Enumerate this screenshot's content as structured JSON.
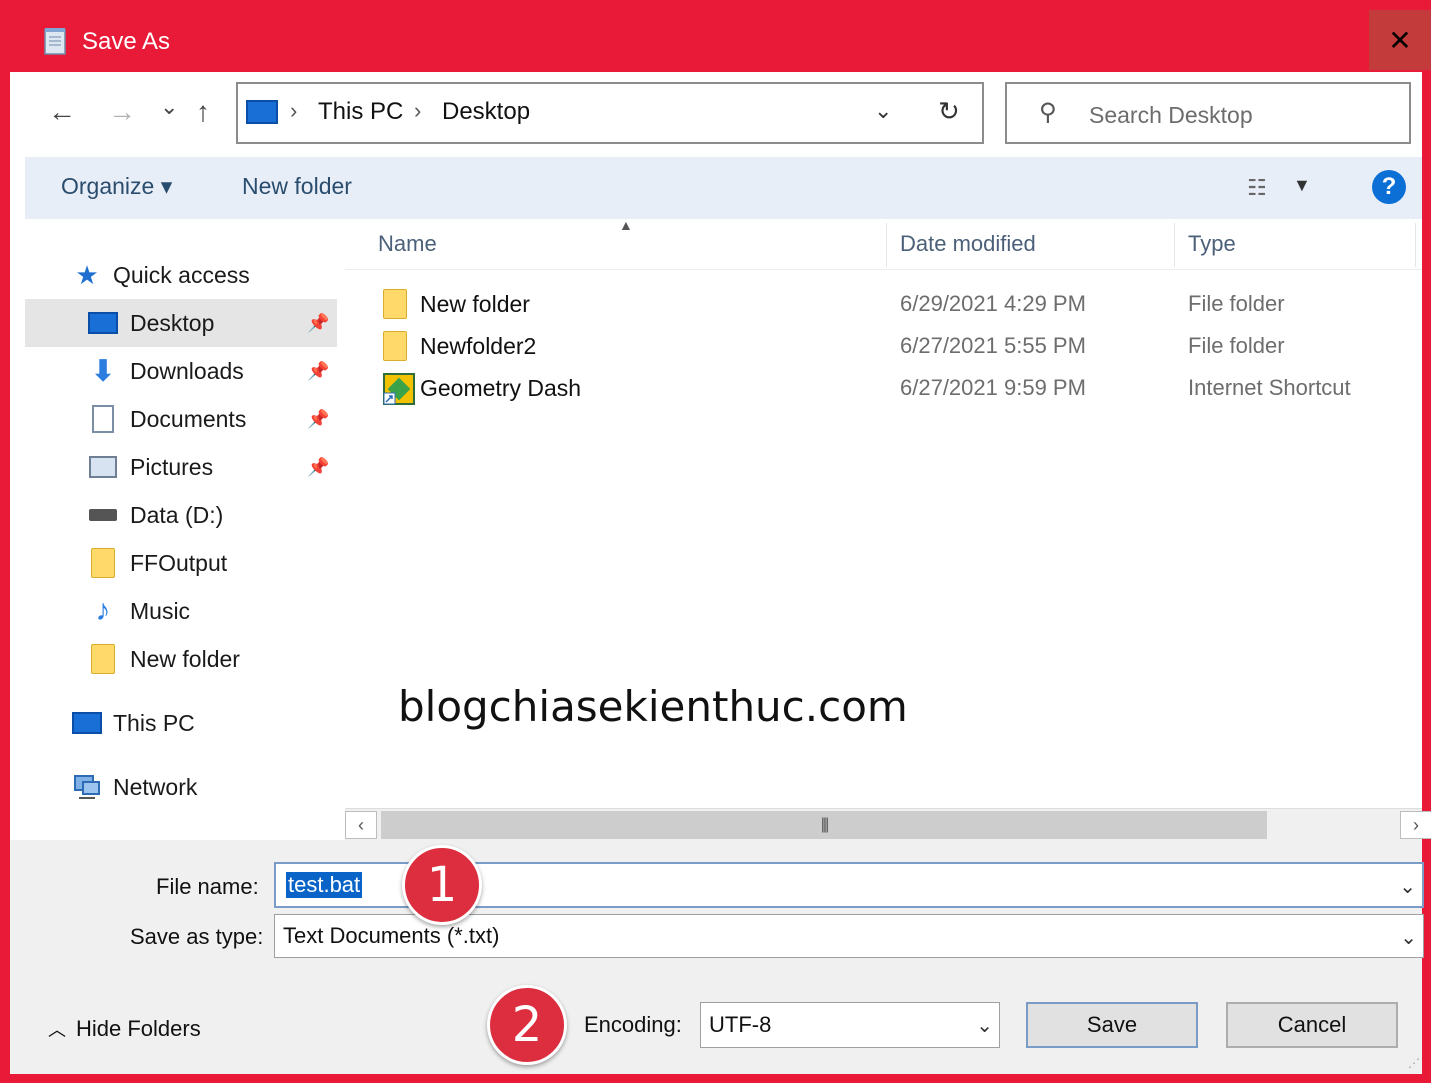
{
  "window": {
    "title": "Save As",
    "close_label": "✕"
  },
  "nav": {
    "back": "←",
    "forward": "→",
    "recent": "⌄",
    "up": "↑",
    "breadcrumb": [
      "This PC",
      "Desktop"
    ],
    "refresh": "↻",
    "search_placeholder": "Search Desktop"
  },
  "toolbar": {
    "organize": "Organize ▾",
    "new_folder": "New folder",
    "help": "?"
  },
  "sidebar": {
    "quick_access": "Quick access",
    "items": [
      {
        "label": "Desktop",
        "icon": "desktop-icon",
        "pinned": true
      },
      {
        "label": "Downloads",
        "icon": "download-icon",
        "pinned": true
      },
      {
        "label": "Documents",
        "icon": "documents-icon",
        "pinned": true
      },
      {
        "label": "Pictures",
        "icon": "pictures-icon",
        "pinned": true
      },
      {
        "label": "Data (D:)",
        "icon": "drive-icon",
        "pinned": false
      },
      {
        "label": "FFOutput",
        "icon": "folder-icon",
        "pinned": false
      },
      {
        "label": "Music",
        "icon": "music-icon",
        "pinned": false
      },
      {
        "label": "New folder",
        "icon": "folder-icon",
        "pinned": false
      }
    ],
    "this_pc": "This PC",
    "network": "Network"
  },
  "filelist": {
    "columns": [
      "Name",
      "Date modified",
      "Type"
    ],
    "rows": [
      {
        "name": "New folder",
        "date": "6/29/2021 4:29 PM",
        "type": "File folder",
        "icon": "folder-icon"
      },
      {
        "name": "Newfolder2",
        "date": "6/27/2021 5:55 PM",
        "type": "File folder",
        "icon": "folder-icon"
      },
      {
        "name": "Geometry Dash",
        "date": "6/27/2021 9:59 PM",
        "type": "Internet Shortcut",
        "icon": "shortcut-icon"
      }
    ]
  },
  "watermark": "blogchiasekienthuc.com",
  "form": {
    "file_name_label": "File name:",
    "file_name_value": "test.bat",
    "save_type_label": "Save as type:",
    "save_type_value": "Text Documents (*.txt)",
    "encoding_label": "Encoding:",
    "encoding_value": "UTF-8",
    "save": "Save",
    "cancel": "Cancel",
    "hide_folders": "Hide Folders"
  },
  "annotations": [
    "1",
    "2"
  ],
  "colors": {
    "accent": "#e81a37",
    "selection": "#0a64c8",
    "badge": "#dc2e3e"
  }
}
